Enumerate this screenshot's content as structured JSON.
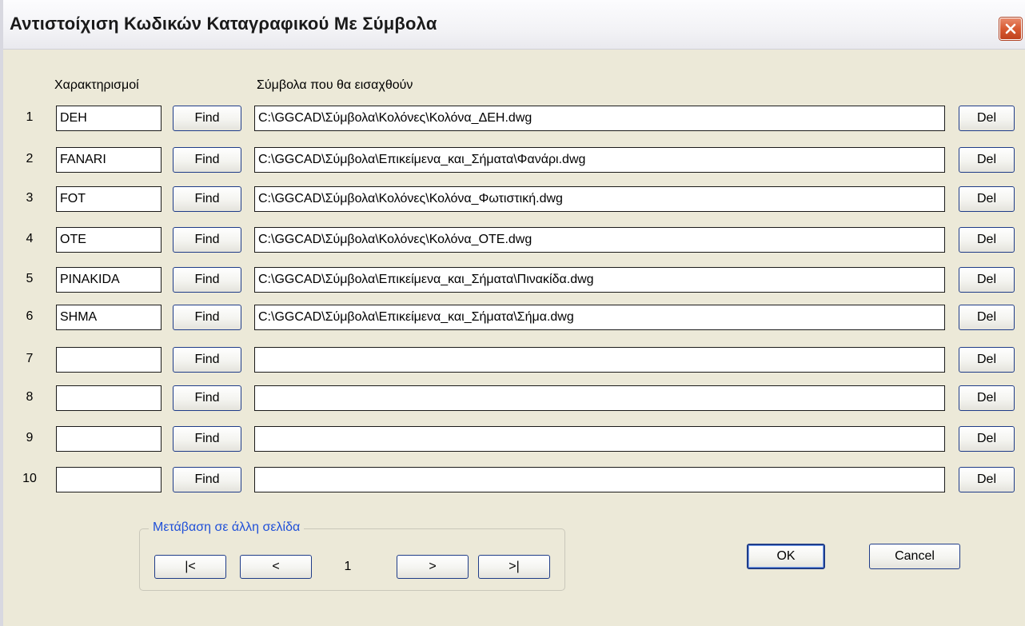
{
  "window": {
    "title": "Αντιστοίχιση Κωδικών Καταγραφικού Με Σύμβολα",
    "close_icon": "close-icon"
  },
  "headers": {
    "codes": "Χαρακτηρισμοί",
    "symbols": "Σύμβολα που θα εισαχθούν"
  },
  "rows": [
    {
      "num": "1",
      "code": "DEH",
      "path": "C:\\GGCAD\\Σύμβολα\\Κολόνες\\Κολόνα_ΔΕΗ.dwg",
      "find": "Find",
      "del": "Del"
    },
    {
      "num": "2",
      "code": "FANARI",
      "path": "C:\\GGCAD\\Σύμβολα\\Επικείμενα_και_Σήματα\\Φανάρι.dwg",
      "find": "Find",
      "del": "Del"
    },
    {
      "num": "3",
      "code": "FOT",
      "path": "C:\\GGCAD\\Σύμβολα\\Κολόνες\\Κολόνα_Φωτιστική.dwg",
      "find": "Find",
      "del": "Del"
    },
    {
      "num": "4",
      "code": "OTE",
      "path": "C:\\GGCAD\\Σύμβολα\\Κολόνες\\Κολόνα_ΟΤΕ.dwg",
      "find": "Find",
      "del": "Del"
    },
    {
      "num": "5",
      "code": "PINAKIDA",
      "path": "C:\\GGCAD\\Σύμβολα\\Επικείμενα_και_Σήματα\\Πινακίδα.dwg",
      "find": "Find",
      "del": "Del"
    },
    {
      "num": "6",
      "code": "SHMA",
      "path": "C:\\GGCAD\\Σύμβολα\\Επικείμενα_και_Σήματα\\Σήμα.dwg",
      "find": "Find",
      "del": "Del"
    },
    {
      "num": "7",
      "code": "",
      "path": "",
      "find": "Find",
      "del": "Del"
    },
    {
      "num": "8",
      "code": "",
      "path": "",
      "find": "Find",
      "del": "Del"
    },
    {
      "num": "9",
      "code": "",
      "path": "",
      "find": "Find",
      "del": "Del"
    },
    {
      "num": "10",
      "code": "",
      "path": "",
      "find": "Find",
      "del": "Del"
    }
  ],
  "pagination": {
    "title": "Μετάβαση σε άλλη σελίδα",
    "first": "|<",
    "prev": "<",
    "page": "1",
    "next": ">",
    "last": ">|"
  },
  "actions": {
    "ok": "OK",
    "cancel": "Cancel"
  },
  "colors": {
    "dialog_bg": "#ece9d8",
    "button_border": "#1f3c88",
    "group_title": "#2050d8",
    "close_button": "#d85a32"
  }
}
